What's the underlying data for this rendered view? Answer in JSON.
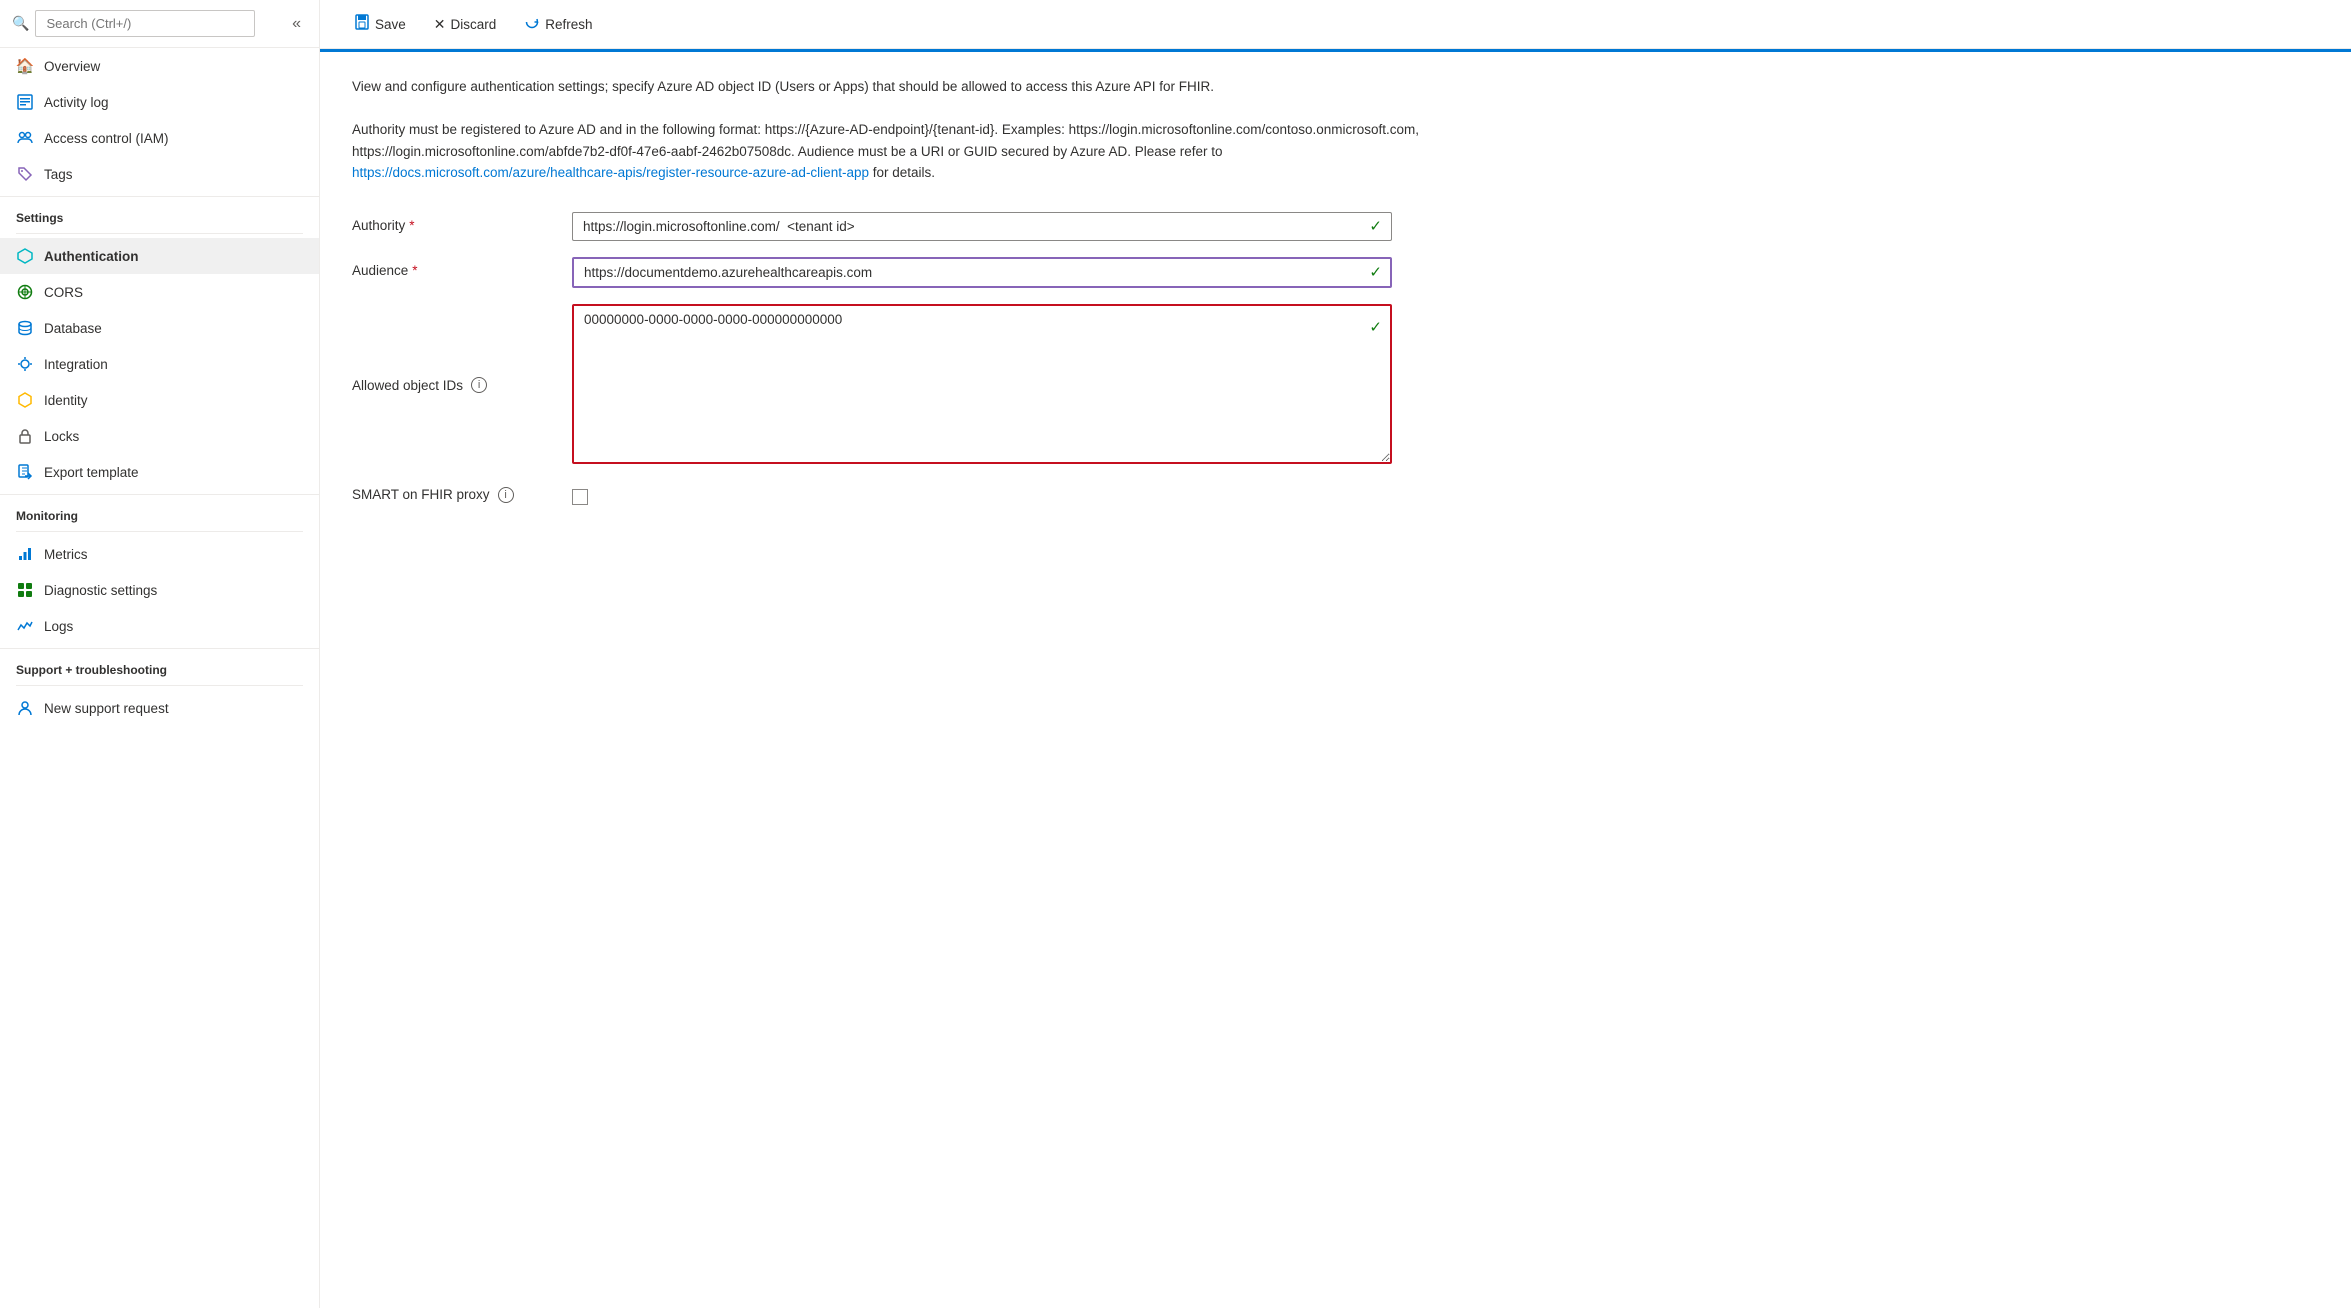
{
  "sidebar": {
    "search": {
      "placeholder": "Search (Ctrl+/)"
    },
    "items": [
      {
        "id": "overview",
        "label": "Overview",
        "icon": "🏠",
        "iconColor": "icon-orange",
        "active": false
      },
      {
        "id": "activity-log",
        "label": "Activity log",
        "icon": "▦",
        "iconColor": "icon-blue",
        "active": false
      },
      {
        "id": "access-control",
        "label": "Access control (IAM)",
        "icon": "👥",
        "iconColor": "icon-blue",
        "active": false
      },
      {
        "id": "tags",
        "label": "Tags",
        "icon": "🏷",
        "iconColor": "icon-purple",
        "active": false
      }
    ],
    "sections": [
      {
        "label": "Settings",
        "items": [
          {
            "id": "authentication",
            "label": "Authentication",
            "icon": "◆",
            "iconColor": "icon-cyan",
            "active": true
          },
          {
            "id": "cors",
            "label": "CORS",
            "icon": "⊕",
            "iconColor": "icon-green",
            "active": false
          },
          {
            "id": "database",
            "label": "Database",
            "icon": "🗄",
            "iconColor": "icon-blue",
            "active": false
          },
          {
            "id": "integration",
            "label": "Integration",
            "icon": "☁",
            "iconColor": "icon-blue",
            "active": false
          },
          {
            "id": "identity",
            "label": "Identity",
            "icon": "⬡",
            "iconColor": "icon-yellow",
            "active": false
          },
          {
            "id": "locks",
            "label": "Locks",
            "icon": "🔒",
            "iconColor": "icon-gray",
            "active": false
          },
          {
            "id": "export-template",
            "label": "Export template",
            "icon": "📋",
            "iconColor": "icon-blue",
            "active": false
          }
        ]
      },
      {
        "label": "Monitoring",
        "items": [
          {
            "id": "metrics",
            "label": "Metrics",
            "icon": "📊",
            "iconColor": "icon-blue",
            "active": false
          },
          {
            "id": "diagnostic-settings",
            "label": "Diagnostic settings",
            "icon": "⊞",
            "iconColor": "icon-green",
            "active": false
          },
          {
            "id": "logs",
            "label": "Logs",
            "icon": "📈",
            "iconColor": "icon-blue",
            "active": false
          }
        ]
      },
      {
        "label": "Support + troubleshooting",
        "items": [
          {
            "id": "new-support-request",
            "label": "New support request",
            "icon": "👤",
            "iconColor": "icon-blue",
            "active": false
          }
        ]
      }
    ]
  },
  "toolbar": {
    "save_label": "Save",
    "discard_label": "Discard",
    "refresh_label": "Refresh"
  },
  "content": {
    "description1": "View and configure authentication settings; specify Azure AD object ID (Users or Apps) that should be allowed to access this Azure API for FHIR.",
    "description2": "Authority must be registered to Azure AD and in the following format: https://{Azure-AD-endpoint}/{tenant-id}. Examples: https://login.microsoftonline.com/contoso.onmicrosoft.com, https://login.microsoftonline.com/abfde7b2-df0f-47e6-aabf-2462b07508dc. Audience must be a URI or GUID secured by Azure AD. Please refer to ",
    "description_link_text": "https://docs.microsoft.com/azure/healthcare-apis/register-resource-azure-ad-client-app",
    "description_link_url": "#",
    "description3": " for details.",
    "fields": {
      "authority": {
        "label": "Authority",
        "required": true,
        "value": "https://login.microsoftonline.com/  <tenant id>",
        "valid": true
      },
      "audience": {
        "label": "Audience",
        "required": true,
        "value": "https://documentdemo.azurehealthcareapis.com",
        "valid": true
      },
      "allowed_object_ids": {
        "label": "Allowed object IDs",
        "value": "00000000-0000-0000-0000-000000000000",
        "valid": true
      },
      "smart_on_fhir": {
        "label": "SMART on FHIR proxy",
        "checked": false
      }
    }
  }
}
